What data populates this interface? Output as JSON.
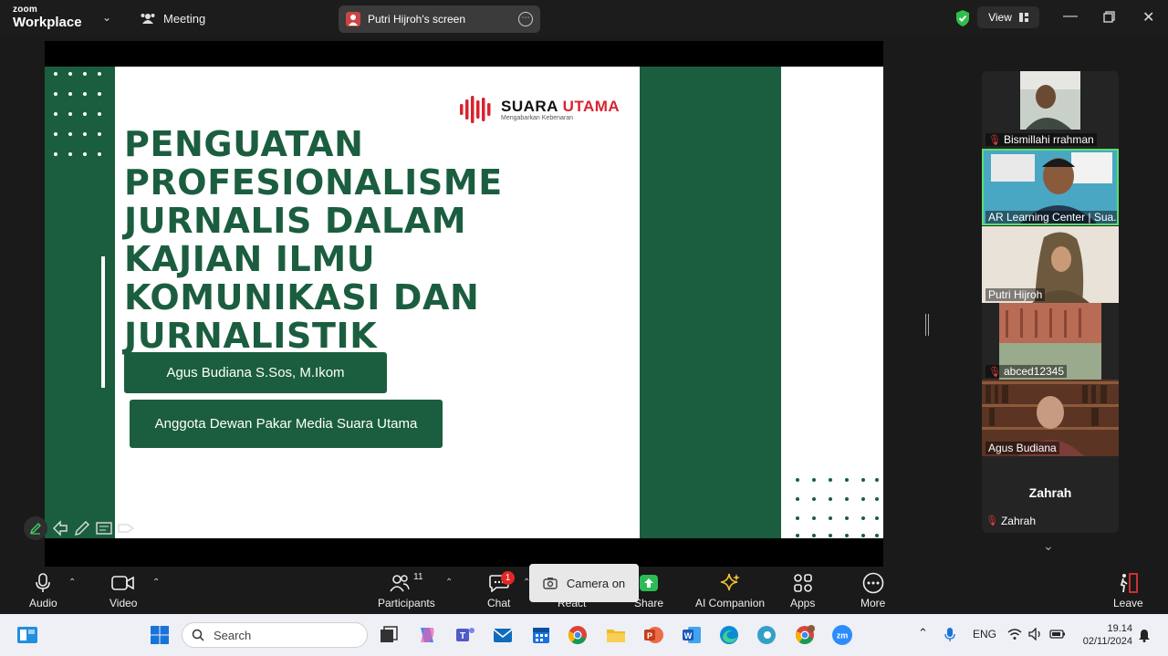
{
  "titlebar": {
    "logo_small": "zoom",
    "logo_big": "Workplace",
    "meeting_label": "Meeting",
    "screen_share_label": "Putri Hijroh's screen",
    "view_label": "View"
  },
  "slide": {
    "brand_name_1": "SUARA",
    "brand_name_2": "UTAMA",
    "brand_tagline": "Mengabarkan Kebenaran",
    "title": "PENGUATAN PROFESIONALISME JURNALIS DALAM KAJIAN ILMU KOMUNIKASI DAN JURNALISTIK",
    "presenter": "Agus Budiana S.Sos, M.Ikom",
    "role": "Anggota Dewan Pakar Media Suara Utama",
    "colors": {
      "green": "#1b5e3f",
      "red": "#d9232d"
    }
  },
  "participants": [
    {
      "name": "Bismillahi rrahman",
      "muted": true
    },
    {
      "name": "AR Learning Center | Sua...",
      "muted": false,
      "active": true
    },
    {
      "name": "Putri Hijroh",
      "muted": false
    },
    {
      "name": "abced12345",
      "muted": true
    },
    {
      "name": "Agus Budiana",
      "muted": false
    },
    {
      "name": "Zahrah",
      "display_name": "Zahrah",
      "muted": true
    }
  ],
  "toolbar": {
    "audio": "Audio",
    "video": "Video",
    "participants": "Participants",
    "participants_count": "11",
    "chat": "Chat",
    "chat_badge": "1",
    "react": "React",
    "share": "Share",
    "ai_companion": "AI Companion",
    "apps": "Apps",
    "more": "More",
    "leave": "Leave",
    "tooltip": "Camera on"
  },
  "taskbar": {
    "search_placeholder": "Search",
    "language": "ENG",
    "time": "19.14",
    "date": "02/11/2024"
  }
}
